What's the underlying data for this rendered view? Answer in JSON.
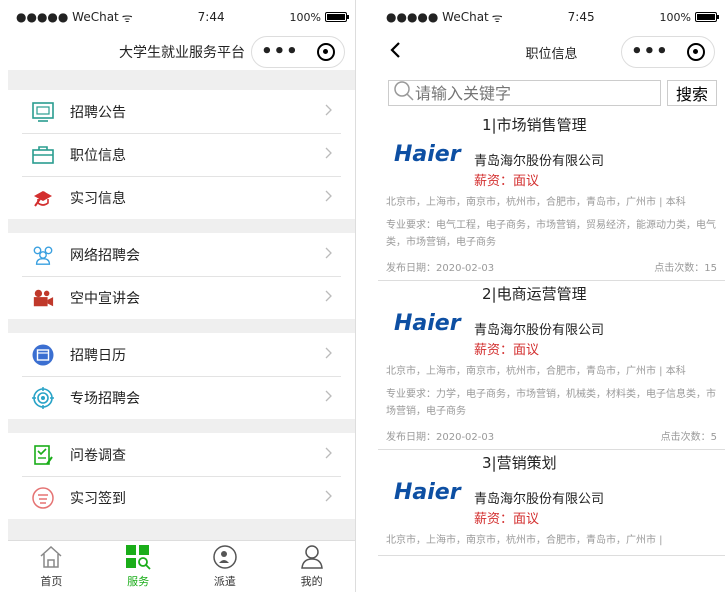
{
  "left": {
    "status": {
      "carrier": "●●●●● WeChat",
      "wifi": "ᯤ",
      "time": "7:44",
      "battery": "100%"
    },
    "title": "大学生就业服务平台",
    "groups": [
      [
        {
          "label": "招聘公告",
          "icon": "notice-icon",
          "color": "#2a9d8f"
        },
        {
          "label": "职位信息",
          "icon": "briefcase-icon",
          "color": "#2a9d8f"
        },
        {
          "label": "实习信息",
          "icon": "cap-icon",
          "color": "#d32f2f"
        }
      ],
      [
        {
          "label": "网络招聘会",
          "icon": "people-icon",
          "color": "#3aa0e0"
        },
        {
          "label": "空中宣讲会",
          "icon": "camera-icon",
          "color": "#c0392b"
        }
      ],
      [
        {
          "label": "招聘日历",
          "icon": "calendar-icon",
          "color": "#3b6fd1"
        },
        {
          "label": "专场招聘会",
          "icon": "target-icon",
          "color": "#29a3c7"
        }
      ],
      [
        {
          "label": "问卷调查",
          "icon": "survey-icon",
          "color": "#1aad19"
        },
        {
          "label": "实习签到",
          "icon": "sign-icon",
          "color": "#e57373"
        }
      ]
    ],
    "tabs": [
      {
        "label": "首页",
        "icon": "home-icon"
      },
      {
        "label": "服务",
        "icon": "grid-icon",
        "active": true
      },
      {
        "label": "派遣",
        "icon": "dispatch-icon"
      },
      {
        "label": "我的",
        "icon": "user-icon"
      }
    ]
  },
  "right": {
    "status": {
      "carrier": "●●●●● WeChat",
      "wifi": "ᯤ",
      "time": "7:45",
      "battery": "100%"
    },
    "title": "职位信息",
    "search": {
      "placeholder": "请输入关键字",
      "button": "搜索"
    },
    "jobs": [
      {
        "title": "1|市场销售管理",
        "company": "青岛海尔股份有限公司",
        "salary": "薪资：面议",
        "logo": "Haier",
        "cities": "北京市，上海市，南京市，杭州市，合肥市，青岛市，广州市 | 本科",
        "majors": "专业要求：电气工程，电子商务，市场营销，贸易经济，能源动力类，电气类，市场营销，电子商务",
        "date": "发布日期：2020-02-03",
        "clicks": "点击次数：15"
      },
      {
        "title": "2|电商运营管理",
        "company": "青岛海尔股份有限公司",
        "salary": "薪资：面议",
        "logo": "Haier",
        "cities": "北京市，上海市，南京市，杭州市，合肥市，青岛市，广州市 | 本科",
        "majors": "专业要求：力学，电子商务，市场营销，机械类，材料类，电子信息类，市场营销，电子商务",
        "date": "发布日期：2020-02-03",
        "clicks": "点击次数：5"
      },
      {
        "title": "3|营销策划",
        "company": "青岛海尔股份有限公司",
        "salary": "薪资：面议",
        "logo": "Haier",
        "cities": "北京市，上海市，南京市，杭州市，合肥市，青岛市，广州市 |"
      }
    ]
  }
}
